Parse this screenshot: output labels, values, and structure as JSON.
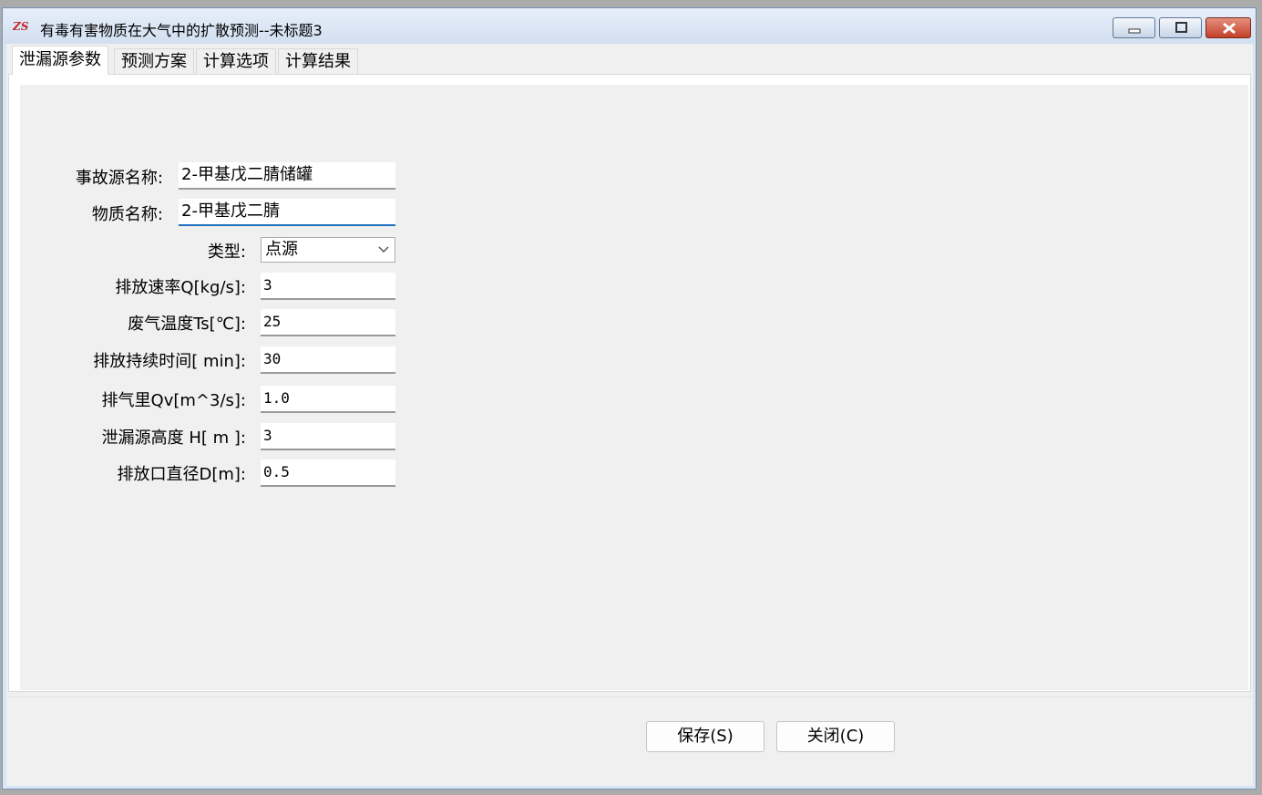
{
  "window": {
    "title": "有毒有害物质在大气中的扩散预测--未标题3"
  },
  "tabs": [
    {
      "label": "泄漏源参数",
      "active": true
    },
    {
      "label": "预测方案",
      "active": false
    },
    {
      "label": "计算选项",
      "active": false
    },
    {
      "label": "计算结果",
      "active": false
    }
  ],
  "form": {
    "accident_source_name": {
      "label": "事故源名称:",
      "value": "2-甲基戊二腈储罐"
    },
    "substance_name": {
      "label": "物质名称:",
      "value": "2-甲基戊二腈"
    },
    "type": {
      "label": "类型:",
      "value": "点源"
    },
    "emission_rate": {
      "label": "排放速率Q[kg/s]:",
      "value": "3"
    },
    "exhaust_temperature": {
      "label": "废气温度Ts[℃]:",
      "value": "25"
    },
    "emission_duration": {
      "label": "排放持续时间[ min]:",
      "value": "30"
    },
    "exhaust_volume": {
      "label": "排气里Qv[m^3/s]:",
      "value": "1.0"
    },
    "source_height": {
      "label": "泄漏源高度 H[  m ]:",
      "value": "3"
    },
    "outlet_diameter": {
      "label": "排放口直径D[m]:",
      "value": "0.5"
    }
  },
  "buttons": {
    "save": "保存(S)",
    "close": "关闭(C)"
  },
  "colors": {
    "focus_underline": "#1f6fbf",
    "close_button": "#c3412a"
  }
}
